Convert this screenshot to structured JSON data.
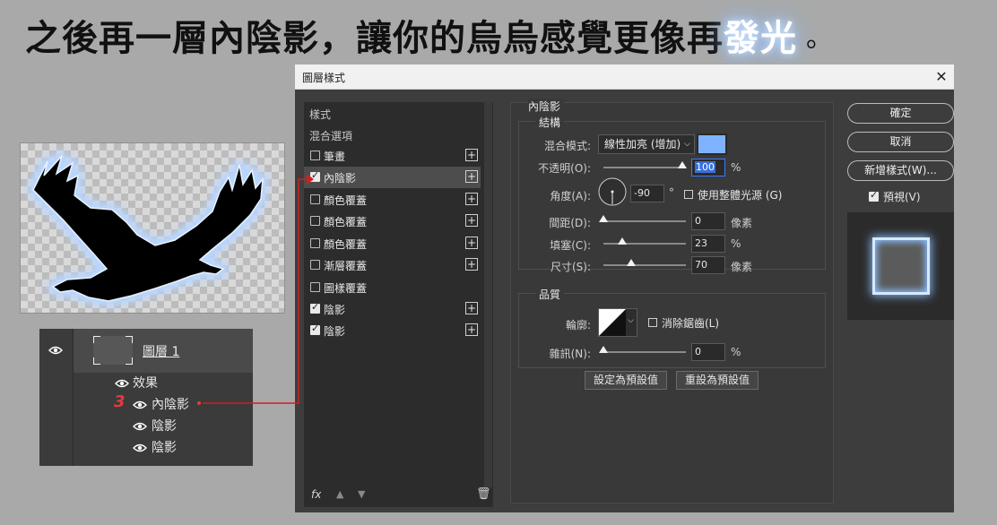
{
  "heading": {
    "main": "之後再一層內陰影，讓你的烏烏感覺更像再",
    "glow": "發光",
    "end": "。"
  },
  "layers_panel": {
    "layer_name": "圖層 1",
    "effects_label": "效果",
    "effects": [
      "內陰影",
      "陰影",
      "陰影"
    ],
    "step_marker": "3"
  },
  "dialog": {
    "title": "圖層樣式",
    "close_glyph": "✕",
    "style_list": {
      "header": "樣式",
      "blend_options": "混合選項",
      "items": [
        {
          "label": "筆畫",
          "checked": false,
          "plus": true
        },
        {
          "label": "內陰影",
          "checked": true,
          "plus": true,
          "selected": true
        },
        {
          "label": "顏色覆蓋",
          "checked": false,
          "plus": true
        },
        {
          "label": "顏色覆蓋",
          "checked": false,
          "plus": true
        },
        {
          "label": "顏色覆蓋",
          "checked": false,
          "plus": true
        },
        {
          "label": "漸層覆蓋",
          "checked": false,
          "plus": true
        },
        {
          "label": "圖樣覆蓋",
          "checked": false,
          "plus": false
        },
        {
          "label": "陰影",
          "checked": true,
          "plus": true
        },
        {
          "label": "陰影",
          "checked": true,
          "plus": true
        }
      ],
      "footer": {
        "fx": "fx",
        "up_icon": "arrow-up-icon",
        "down_icon": "arrow-down-icon",
        "trash_icon": "trash-icon"
      }
    },
    "inner_shadow": {
      "section_title": "內陰影",
      "structure_label": "結構",
      "blend_mode_label": "混合模式:",
      "blend_mode_value": "線性加亮 (增加)",
      "shadow_color": "#7fb2ff",
      "opacity_label": "不透明(O):",
      "opacity_value": "100",
      "angle_label": "角度(A):",
      "angle_value": "-90",
      "degree_unit": "°",
      "global_light_label": "使用整體光源 (G)",
      "distance_label": "間距(D):",
      "distance_value": "0",
      "choke_label": "填塞(C):",
      "choke_value": "23",
      "size_label": "尺寸(S):",
      "size_value": "70",
      "unit_percent": "%",
      "unit_pixels": "像素",
      "quality_label": "品質",
      "contour_label": "輪廓:",
      "antialias_label": "消除鋸齒(L)",
      "noise_label": "雜訊(N):",
      "noise_value": "0",
      "set_default": "設定為預設值",
      "reset_default": "重設為預設值"
    },
    "buttons": {
      "ok": "確定",
      "cancel": "取消",
      "new_style": "新增樣式(W)...",
      "preview": "預視(V)"
    }
  }
}
